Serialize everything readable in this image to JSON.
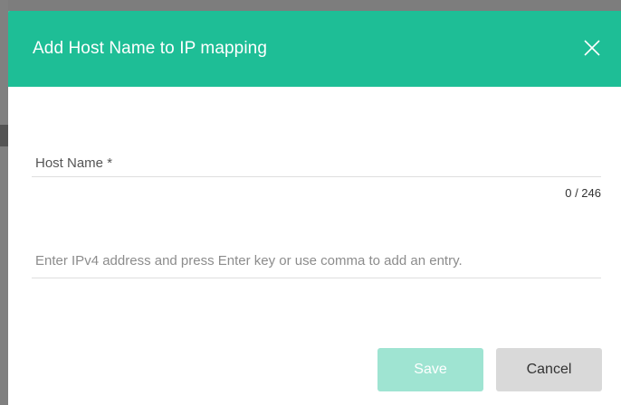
{
  "dialog": {
    "title": "Add Host Name to IP mapping",
    "close_icon": "close-icon"
  },
  "hostname_field": {
    "label": "Host Name *",
    "value": "",
    "counter": "0 / 246"
  },
  "ip_field": {
    "placeholder": "Enter IPv4 address and press Enter key or use comma to add an entry.",
    "value": ""
  },
  "actions": {
    "save_label": "Save",
    "cancel_label": "Cancel"
  },
  "colors": {
    "header": "#1ebe96",
    "save_disabled": "#9fe4d2",
    "cancel": "#d9d9d9"
  }
}
